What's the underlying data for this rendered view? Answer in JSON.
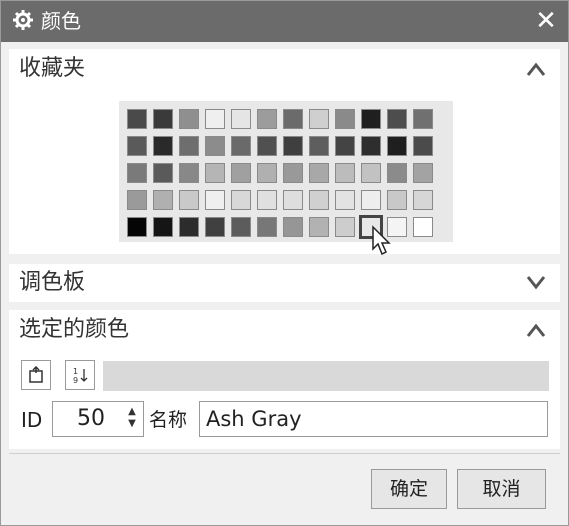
{
  "window": {
    "title": "颜色",
    "icon": "gear-icon",
    "close_symbol": "✕"
  },
  "sections": {
    "favorites": {
      "title": "收藏夹",
      "state": "expanded"
    },
    "palette": {
      "title": "调色板",
      "state": "collapsed"
    },
    "selected": {
      "title": "选定的颜色",
      "state": "expanded"
    }
  },
  "favorites_palette": {
    "rows": [
      [
        "#4a4a4a",
        "#3a3a3a",
        "#8f8f8f",
        "#efefef",
        "#e5e5e5",
        "#9c9c9c",
        "#6b6b6b",
        "#cfcfcf",
        "#8a8a8a",
        "#1f1f1f",
        "#4d4d4d",
        "#707070"
      ],
      [
        "#5a5a5a",
        "#2a2a2a",
        "#6e6e6e",
        "#8c8c8c",
        "#6a6a6a",
        "#505050",
        "#3f3f3f",
        "#5e5e5e",
        "#444444",
        "#2e2e2e",
        "#1f1f1f",
        "#4b4b4b"
      ],
      [
        "#7a7a7a",
        "#5a5a5a",
        "#888888",
        "#b5b5b5",
        "#a0a0a0",
        "#b0b0b0",
        "#999999",
        "#a8a8a8",
        "#bcbcbc",
        "#c2c2c2",
        "#8b8b8b",
        "#a3a3a3"
      ],
      [
        "#9a9a9a",
        "#b0b0b0",
        "#c9c9c9",
        "#efefef",
        "#d8d8d8",
        "#e0e0e0",
        "#dedede",
        "#d0d0d0",
        "#e3e3e3",
        "#eeeeee",
        "#c8c8c8",
        "#d6d6d6"
      ],
      [
        "#050505",
        "#151515",
        "#2c2c2c",
        "#404040",
        "#5c5c5c",
        "#777777",
        "#969696",
        "#b2b2b2",
        "#cdcdcd",
        "#e8e8e8",
        "#f4f4f4",
        "#ffffff"
      ]
    ],
    "selected_row": 4,
    "selected_col": 9
  },
  "selected_color": {
    "id_label": "ID",
    "id_value": "50",
    "name_label": "名称",
    "name_value": "Ash Gray",
    "preview_color": "#d9d9d9"
  },
  "tools": [
    {
      "name": "add-to-favorites-icon"
    },
    {
      "name": "sort-numeric-icon"
    }
  ],
  "buttons": {
    "ok": "确定",
    "cancel": "取消"
  },
  "colors": {
    "titlebar": "#6b6b6b",
    "dialog_bg": "#f0f0f0",
    "section_bg": "#ffffff"
  }
}
